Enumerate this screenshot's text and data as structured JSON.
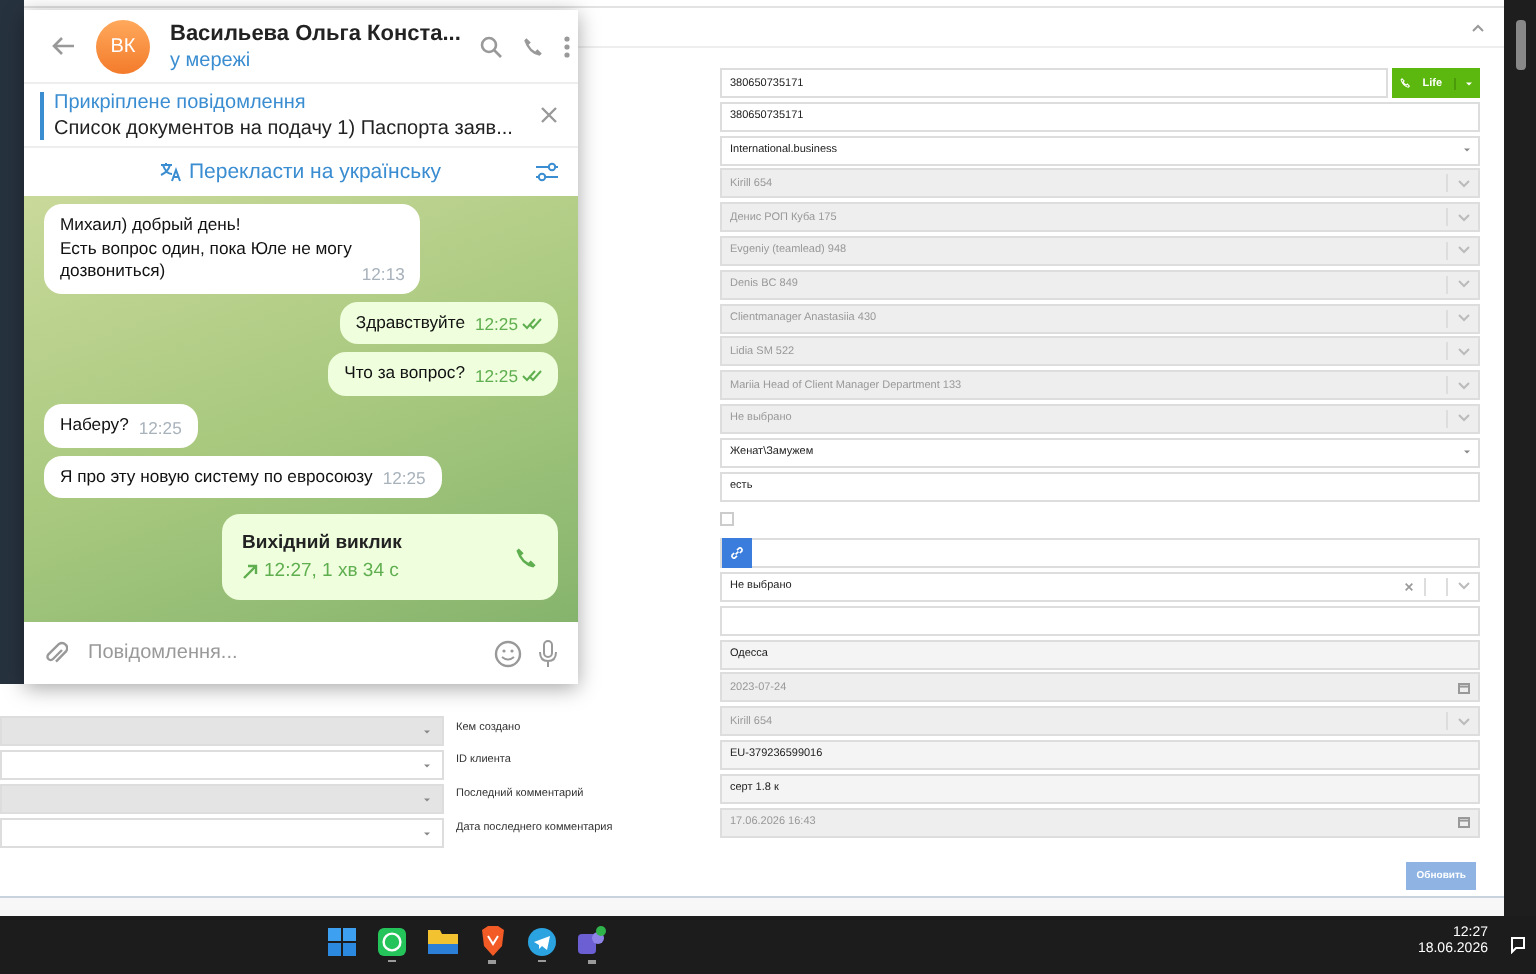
{
  "crm": {
    "fields": [
      {
        "kind": "input",
        "value": "380650735171",
        "call_button": "Life"
      },
      {
        "kind": "input",
        "value": "380650735171"
      },
      {
        "kind": "select",
        "value": "International.business"
      },
      {
        "kind": "select",
        "value": "Kirill 654",
        "disabled": true
      },
      {
        "kind": "select",
        "value": "Денис РОП Куба 175",
        "disabled": true
      },
      {
        "kind": "select",
        "value": "Evgeniy (teamlead) 948",
        "disabled": true
      },
      {
        "kind": "select",
        "value": "Denis BC 849",
        "disabled": true
      },
      {
        "kind": "select",
        "value": "Clientmanager Anastasiia 430",
        "disabled": true
      },
      {
        "kind": "select",
        "value": "Lidia SM 522",
        "disabled": true
      },
      {
        "kind": "select",
        "value": "Mariia Head of Client Manager Department 133",
        "disabled": true
      },
      {
        "kind": "select",
        "value": "Не выбрано",
        "disabled": true
      },
      {
        "kind": "select",
        "value": "Женат\\Замужем"
      },
      {
        "kind": "input",
        "value": "есть"
      },
      {
        "kind": "checkbox",
        "checked": false
      },
      {
        "kind": "link"
      },
      {
        "kind": "select",
        "value": "Не выбрано",
        "clearable": true
      },
      {
        "kind": "input"
      },
      {
        "kind": "input",
        "value": "Одесса",
        "readonly": true
      },
      {
        "kind": "date",
        "value": "2023-07-24",
        "disabled": true
      },
      {
        "kind": "select",
        "value": "Kirill 654",
        "disabled": true,
        "label": "Кем создано"
      },
      {
        "kind": "input",
        "value": "EU-379236599016",
        "readonly": true,
        "label": "ID клиента"
      },
      {
        "kind": "input",
        "value": "серт 1.8 к",
        "readonly": true,
        "label": "Последний комментарий"
      },
      {
        "kind": "date",
        "value": "17.06.2026 16:43",
        "disabled": true,
        "label": "Дата последнего комментария"
      }
    ],
    "left_selects": [
      {
        "disabled": true
      },
      {
        "disabled": false
      },
      {
        "disabled": true
      },
      {
        "disabled": false
      }
    ],
    "update_button": "Обновить"
  },
  "telegram": {
    "avatar": "ВК",
    "name": "Васильева Ольга Конста...",
    "status": "у мережі",
    "pinned": {
      "title": "Прикріплене повідомлення",
      "text": "Список документов на подачу  1) Паспорта заяв..."
    },
    "translate": "Перекласти на українську",
    "messages": [
      {
        "kind": "text",
        "outgoing": false,
        "text": "Михаил) добрый день!\nЕсть вопрос один, пока Юле не могу\nдозвониться)",
        "time": "12:13"
      },
      {
        "kind": "text",
        "outgoing": true,
        "text": "Здравствуйте",
        "time": "12:25",
        "read": true
      },
      {
        "kind": "text",
        "outgoing": true,
        "text": "Что за вопрос?",
        "time": "12:25",
        "read": true
      },
      {
        "kind": "text",
        "outgoing": false,
        "text": "Наберу?",
        "time": "12:25"
      },
      {
        "kind": "text",
        "outgoing": false,
        "text": "Я про эту новую систему по евросоюзу",
        "time": "12:25"
      },
      {
        "kind": "call",
        "outgoing": true,
        "text": "Вихідний виклик",
        "time": "12:27, 1 хв 34 с"
      }
    ],
    "input_placeholder": "Повідомлення..."
  },
  "taskbar": {
    "apps": [
      {
        "kind": "start"
      },
      {
        "kind": "chat",
        "running": true
      },
      {
        "kind": "folder",
        "running": false
      },
      {
        "kind": "shield",
        "running": true
      },
      {
        "kind": "plane",
        "running": true
      },
      {
        "kind": "people",
        "running": true
      }
    ],
    "time": "12:27",
    "date": "18.06.2026"
  }
}
